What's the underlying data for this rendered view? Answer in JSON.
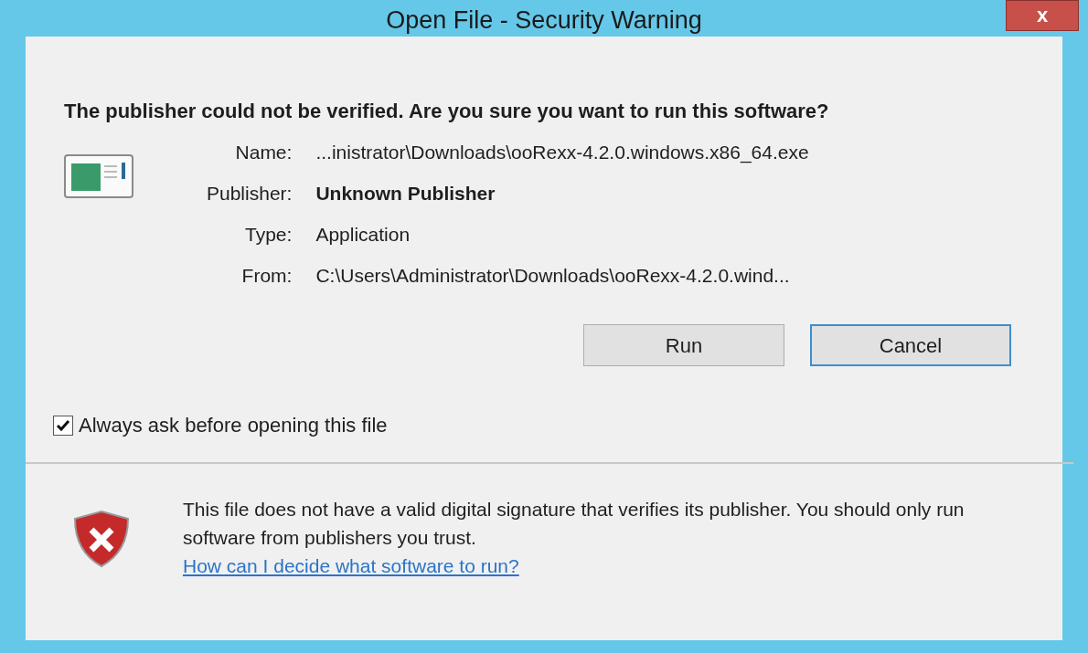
{
  "window": {
    "title": "Open File - Security Warning",
    "close": "x"
  },
  "heading": "The publisher could not be verified.  Are you sure you want to run this software?",
  "fields": [
    {
      "label": "Name:",
      "value": "...inistrator\\Downloads\\ooRexx-4.2.0.windows.x86_64.exe",
      "bold": false
    },
    {
      "label": "Publisher:",
      "value": "Unknown Publisher",
      "bold": true
    },
    {
      "label": "Type:",
      "value": "Application",
      "bold": false
    },
    {
      "label": "From:",
      "value": "C:\\Users\\Administrator\\Downloads\\ooRexx-4.2.0.wind...",
      "bold": false
    }
  ],
  "buttons": [
    {
      "label": "Run",
      "focused": false
    },
    {
      "label": "Cancel",
      "focused": true
    }
  ],
  "checkbox": {
    "label": "Always ask before opening this file",
    "checked": true
  },
  "warning": {
    "text": "This file does not have a valid digital signature that verifies its publisher.  You should only run software from publishers you trust.",
    "link": "How can I decide what software to run?"
  }
}
